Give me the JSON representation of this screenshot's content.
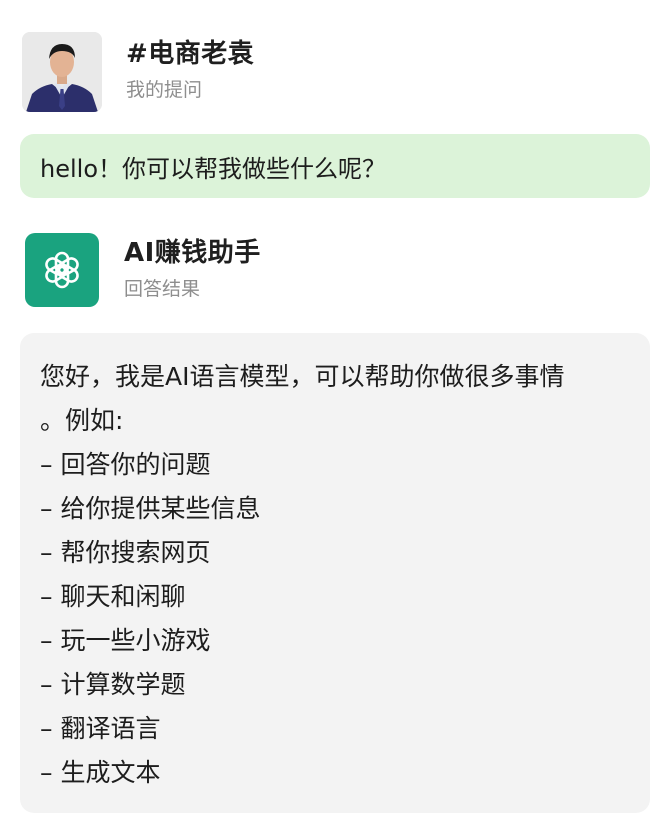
{
  "user": {
    "name": "#电商老袁",
    "subtitle": "我的提问",
    "avatar_icon": "person-photo-icon"
  },
  "question": {
    "text": "hello！你可以帮我做些什么呢？",
    "bubble_color": "#dcf3d9"
  },
  "assistant": {
    "name": "AI赚钱助手",
    "subtitle": "回答结果",
    "logo_icon": "openai-knot-icon",
    "brand_color": "#1aa37f"
  },
  "answer": {
    "intro_line1": "您好，我是AI语言模型，可以帮助你做很多事情",
    "intro_line2": "。例如:",
    "items": [
      "– 回答你的问题",
      "– 给你提供某些信息",
      "– 帮你搜索网页",
      "– 聊天和闲聊",
      "– 玩一些小游戏",
      "– 计算数学题",
      "– 翻译语言",
      "– 生成文本"
    ],
    "card_color": "#f3f3f3"
  }
}
